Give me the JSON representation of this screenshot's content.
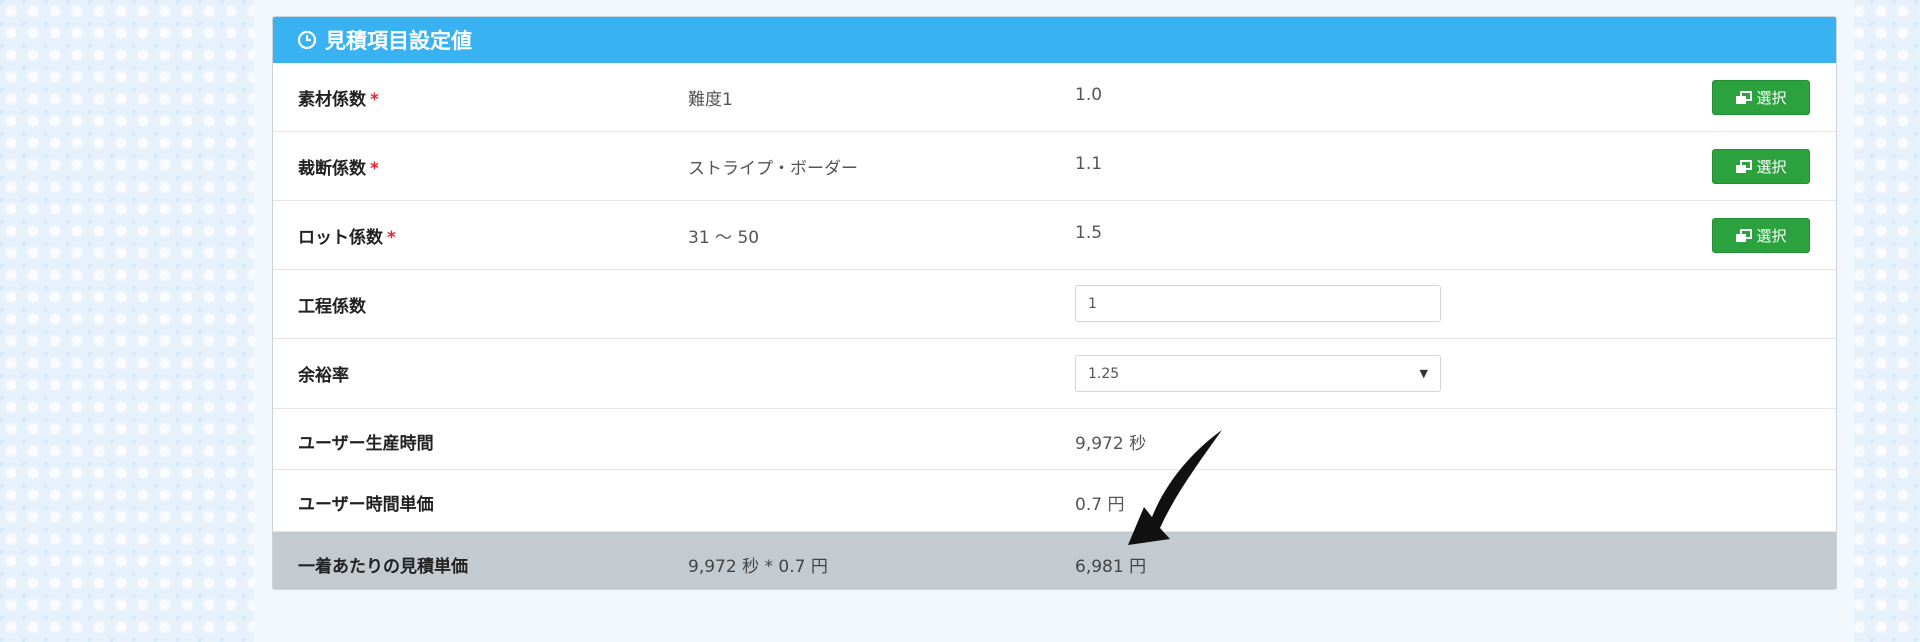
{
  "panel": {
    "title": "見積項目設定値",
    "rows": [
      {
        "label": "素材係数",
        "required": "*",
        "desc": "難度1",
        "value": "1.0",
        "button": "選択"
      },
      {
        "label": "裁断係数",
        "required": "*",
        "desc": "ストライプ・ボーダー",
        "value": "1.1",
        "button": "選択"
      },
      {
        "label": "ロット係数",
        "required": "*",
        "desc": "31 ～ 50",
        "value": "1.5",
        "button": "選択"
      },
      {
        "label": "工程係数",
        "input_value": "1"
      },
      {
        "label": "余裕率",
        "select_value": "1.25"
      },
      {
        "label": "ユーザー生産時間",
        "value": "9,972 秒"
      },
      {
        "label": "ユーザー時間単価",
        "value": "0.7 円"
      },
      {
        "label": "一着あたりの見積単価",
        "desc": "9,972 秒 * 0.7 円",
        "value": "6,981 円"
      }
    ]
  },
  "colors": {
    "header": "#38b2f0",
    "select_button": "#2ca23f",
    "required_mark": "#e0292e",
    "total_row": "#c4cbd0"
  },
  "icons": {
    "header": "clock-icon",
    "button": "window-restore-icon",
    "annotation": "arrow-icon"
  }
}
